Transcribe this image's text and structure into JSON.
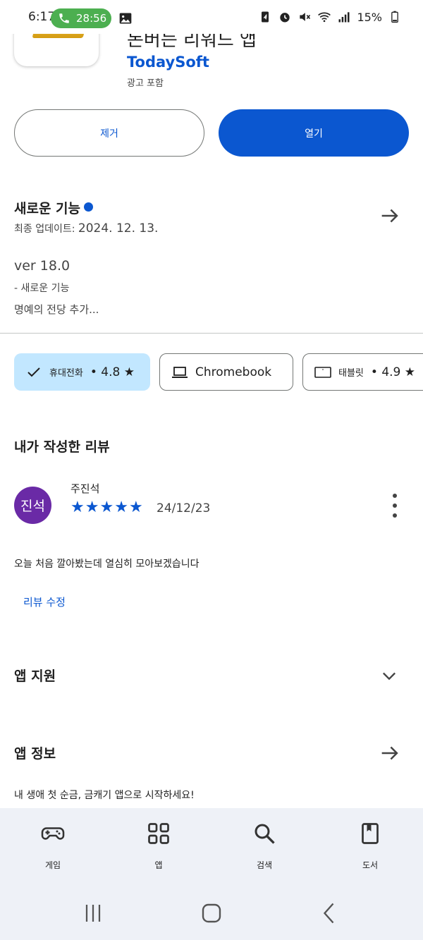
{
  "status_bar": {
    "time": "6:17",
    "call_timer": "28:56",
    "battery": "15%"
  },
  "app": {
    "title_partial": "돈버는 리워드 앱",
    "developer": "TodaySoft",
    "ads_label": "광고 포함"
  },
  "actions": {
    "uninstall_label": "제거",
    "open_label": "열기"
  },
  "whats_new": {
    "title": "새로운 기능",
    "last_updated_label": "최종 업데이트:",
    "last_updated_date": "2024. 12. 13.",
    "version": "ver 18.0",
    "line1": "- 새로운 기능",
    "line2": "명예의 전당 추가..."
  },
  "device_chips": {
    "phone": {
      "label": "휴대전화",
      "rating": "• 4.8 ★"
    },
    "chromebook": {
      "label": "Chromebook"
    },
    "tablet": {
      "label": "태블릿",
      "rating": "• 4.9 ★"
    }
  },
  "my_review": {
    "title": "내가 작성한 리뷰",
    "avatar_text": "진석",
    "reviewer_name": "주진석",
    "stars": 5,
    "date": "24/12/23",
    "text": "오늘 처음 깔아봤는데 열심히 모아보겠습니다",
    "edit_label": "리뷰 수정"
  },
  "app_support": {
    "title": "앱 지원"
  },
  "app_info": {
    "title": "앱 정보",
    "description": "내 생애 첫 순금, 금캐기 앱으로 시작하세요!"
  },
  "bottom_nav": {
    "games": "게임",
    "apps": "앱",
    "search": "검색",
    "books": "도서"
  },
  "colors": {
    "accent": "#0b57d0",
    "chip_selected": "#c2e7ff",
    "avatar": "#6a2aa6",
    "nav_bg": "#eef1f7"
  }
}
